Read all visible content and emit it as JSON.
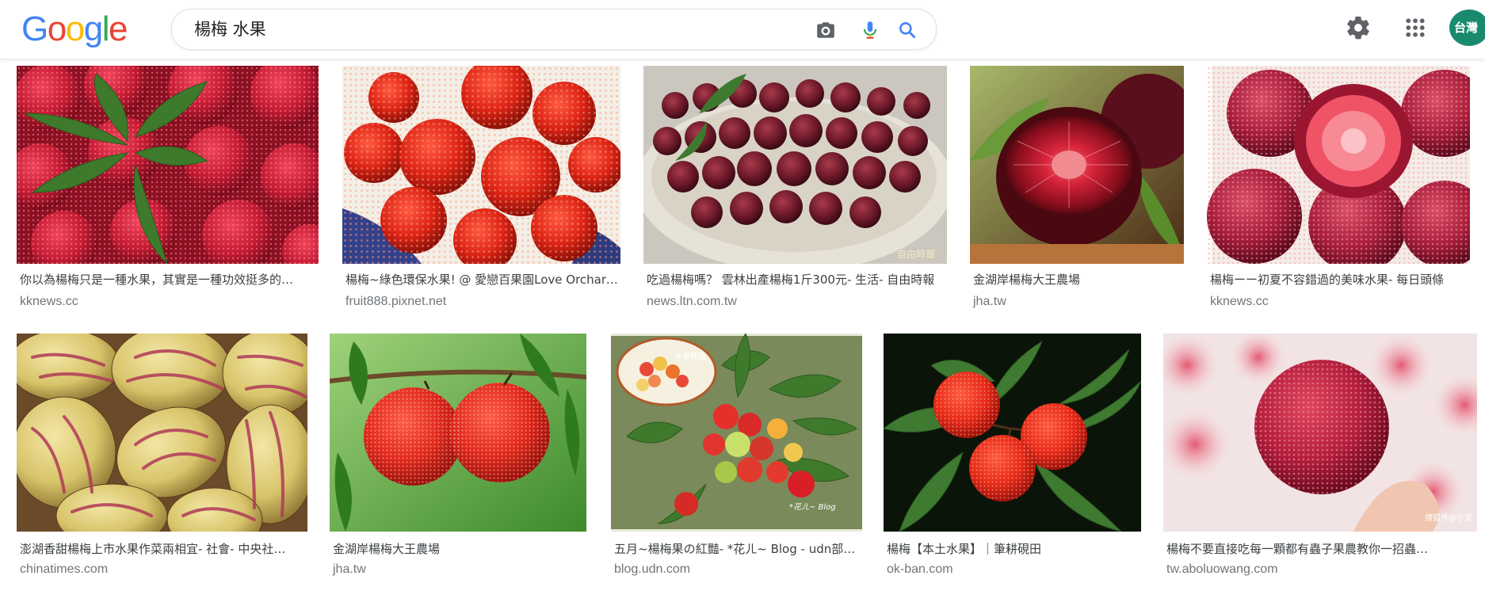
{
  "header": {
    "logo_letters": [
      {
        "ch": "G",
        "color": "#4285f4"
      },
      {
        "ch": "o",
        "color": "#ea4335"
      },
      {
        "ch": "o",
        "color": "#fbbc05"
      },
      {
        "ch": "g",
        "color": "#4285f4"
      },
      {
        "ch": "l",
        "color": "#34a853"
      },
      {
        "ch": "e",
        "color": "#ea4335"
      }
    ],
    "search_value": "楊梅 水果",
    "avatar_text": "台灣",
    "icons": [
      "camera-icon",
      "microphone-icon",
      "search-icon",
      "settings-gear-icon",
      "apps-grid-icon"
    ]
  },
  "results": [
    {
      "caption": "你以為楊梅只是一種水果，其實是一種功效挺多的…",
      "source": "kknews.cc",
      "subject": "bayberries with leaves"
    },
    {
      "caption": "楊梅~綠色環保水果! @ 愛戀百果園Love Orchard…",
      "source": "fruit888.pixnet.net",
      "subject": "bayberry pile"
    },
    {
      "caption": "吃過楊梅嗎？ 雲林出產楊梅1斤300元- 生活- 自由時報",
      "source": "news.ltn.com.tw",
      "subject": "dark bayberries on plate"
    },
    {
      "caption": "金湖岸楊梅大王農場",
      "source": "jha.tw",
      "subject": "bayberry cross-section"
    },
    {
      "caption": "楊梅ーー初夏不容錯過的美味水果- 每日頭條",
      "source": "kknews.cc",
      "subject": "cut bayberry"
    },
    {
      "caption": "澎湖香甜楊梅上市水果作菜兩相宜- 社會- 中央社…",
      "source": "chinatimes.com",
      "subject": "yellow striped melons"
    },
    {
      "caption": "金湖岸楊梅大王農場",
      "source": "jha.tw",
      "subject": "bayberries on branch"
    },
    {
      "caption": "五月~楊梅果の紅豔- *花ㄦ~ Blog - udn部落格",
      "source": "blog.udn.com",
      "subject": "bayberry tree branch"
    },
    {
      "caption": "楊梅【本土水果】｜筆耕硯田",
      "source": "ok-ban.com",
      "subject": "three red bayberries"
    },
    {
      "caption": "楊梅不要直接吃每一顆都有蟲子果農教你一招蟲…",
      "source": "tw.aboluowang.com",
      "subject": "bayberry held in fingers"
    }
  ]
}
